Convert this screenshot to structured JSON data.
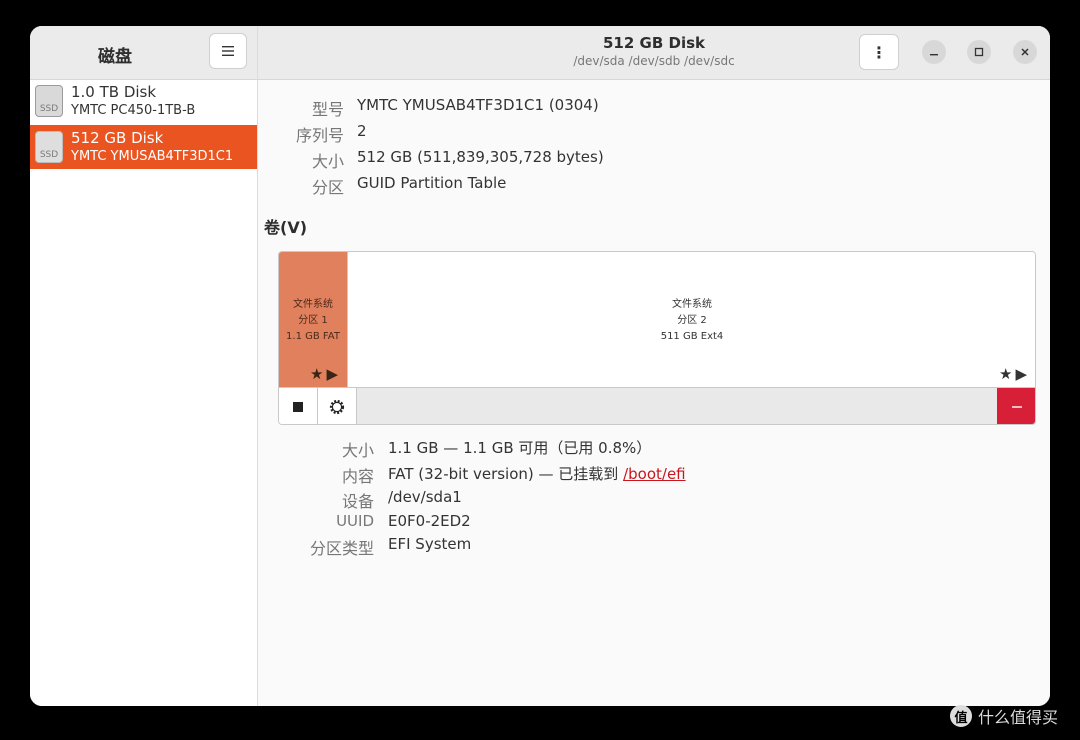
{
  "sidebar": {
    "title": "磁盘",
    "disks": [
      {
        "name": "1.0 TB Disk",
        "model": "YMTC PC450-1TB-B",
        "icon_label": "SSD"
      },
      {
        "name": "512 GB Disk",
        "model": "YMTC YMUSAB4TF3D1C1",
        "icon_label": "SSD"
      }
    ]
  },
  "header": {
    "title": "512 GB Disk",
    "subtitle": "/dev/sda /dev/sdb /dev/sdc"
  },
  "icons": {
    "menu": "hamburger-icon",
    "kebab": "vertical-dots-icon",
    "minimize": "minimize-icon",
    "maximize": "maximize-icon",
    "close": "close-icon",
    "stop": "stop-square-icon",
    "settings": "gear-icon",
    "delete": "minus-icon",
    "star": "star-icon",
    "play": "play-icon"
  },
  "disk_info": {
    "model_label": "型号",
    "model_value": "YMTC YMUSAB4TF3D1C1 (0304)",
    "serial_label": "序列号",
    "serial_value": "2",
    "size_label": "大小",
    "size_value": "512 GB (511,839,305,728 bytes)",
    "partition_label": "分区",
    "partition_value": "GUID Partition Table"
  },
  "volumes": {
    "title": "卷(V)",
    "partitions": [
      {
        "line1": "文件系统",
        "line2": "分区 1",
        "line3": "1.1 GB FAT"
      },
      {
        "line1": "文件系统",
        "line2": "分区 2",
        "line3": "511 GB Ext4"
      }
    ]
  },
  "partition_detail": {
    "size_label": "大小",
    "size_value": "1.1 GB — 1.1 GB 可用（已用 0.8%）",
    "content_label": "内容",
    "content_value": "FAT (32-bit version) — 已挂载到 ",
    "mount_point": "/boot/efi",
    "device_label": "设备",
    "device_value": "/dev/sda1",
    "uuid_label": "UUID",
    "uuid_value": "E0F0-2ED2",
    "type_label": "分区类型",
    "type_value": "EFI System"
  },
  "watermark": {
    "text": "什么值得买",
    "logo": "值"
  },
  "colors": {
    "accent": "#e95420",
    "partition_selected": "#e0805c",
    "danger": "#d71f38",
    "link": "#c7161f"
  }
}
